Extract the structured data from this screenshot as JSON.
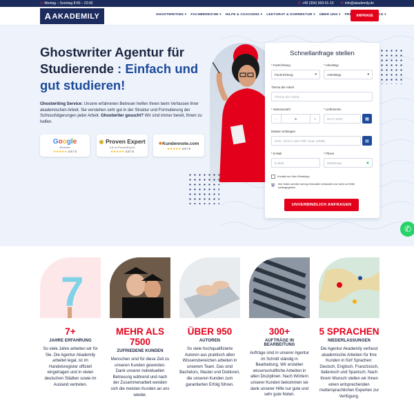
{
  "topbar": {
    "hours": "Montag – Sonntag 8:00 – 23:00",
    "phone": "+49 (304) 669-01-10",
    "email": "info@akademily.de"
  },
  "header": {
    "logo_text": "AKADEMILY",
    "nav": [
      "GHOSTWRITING ▾",
      "FACHBEREICHE ▾",
      "HILFE & COACHING ▾",
      "LEKTORAT & KORREKTUR ▾",
      "ÜBER UNS ▾",
      "PREISE",
      "FAQ",
      "BLOG ▾"
    ],
    "cta": "ANFRAGE"
  },
  "hero": {
    "title_1": "Ghostwriter Agentur für Studierende",
    "title_2": " : Einfach und gut studieren!",
    "lead_b1": "Ghostwriting Service:",
    "lead_t1": " Unsere erfahrenen Betreuer helfen Ihnen beim Verfassen ihrer akademischen Arbeit. Sie verstehen sehr gut in der Struktur und Formulierung der Schlussfolgerungen jeder Arbeit. ",
    "lead_b2": "Ghostwriter gesucht?",
    "lead_t2": " Wir sind immer bereit, Ihnen zu helfen.",
    "badges": [
      {
        "name": "Google",
        "sub": "Reviews",
        "rating": "4.8 / 5"
      },
      {
        "name": "Proven Expert",
        "sub": "4.8 on ProvenExpert",
        "rating": "4.8 / 5"
      },
      {
        "name": "Kundennote.com",
        "sub": "",
        "rating": "4.9 / 5"
      }
    ],
    "stars": "★★★★★"
  },
  "form": {
    "title": "Schnellanfrage stellen",
    "l_fach": "* Fachrichtung",
    "v_fach": "Fachrichtung",
    "l_art": "* Arbeitstyp",
    "v_art": "Arbeitstyp",
    "l_thema": "Thema der Arbeit",
    "p_thema": "Thema der Arbeit...",
    "l_seiten": "* Seitenanzahl",
    "v_seiten": "5",
    "minus": "-",
    "plus": "+",
    "l_termin": "* Liefertermin",
    "p_termin": "02.07.2024",
    "l_datei": "Dateien anhängen",
    "p_datei": "DOC, DOCX oder PDF (max 10MB)",
    "l_email": "* E-Mail",
    "p_email": "E-Mail",
    "l_phone": "* Phone",
    "p_phone": "WhatsApp",
    "cb1": "Kontakt nur über WhatsApp",
    "cb2": "Ihre Daten werden streng vertraulich behandelt und nicht an Dritte weitergegeben.",
    "submit": "UNVERBINDLICH ANFRAGEN"
  },
  "stats": [
    {
      "num": "7+",
      "label": "JAHRE ERFAHRUNG",
      "text": "So viele Jahre arbeiten wir für Sie. Die Agentur Akademily arbeitet legal, ist im Handelsregister offiziell eingetragen und in vielen deutschen Städten sowie im Ausland vertreten."
    },
    {
      "num": "MEHR ALS 7500",
      "label": "ZUFRIEDENE KUNDEN",
      "text": "Menschen sind für diese Zeit zu unseren Kunden geworden. Dank unserer individuellen Betreuung während und nach der Zusammenarbeit wenden sich die meisten Kunden an uns wieder."
    },
    {
      "num": "ÜBER 950",
      "label": "AUTOREN",
      "text": "So viele hochqualifizierte Autoren aus praktisch allen Wissensbereichen arbeiten in unserem Team. Das sind Bachelors, Master und Doktoren, die unseren Kunden zum garantierten Erfolg führen."
    },
    {
      "num": "300+",
      "label": "AUFTRÄGE IN BEARBEITUNG",
      "text": "Aufträge sind in unserer Agentur im Schnitt ständig in Bearbeitung. Wir erstellen wissenschaftliche Arbeiten in allen Disziplinen. Nach Wörtern unserer Kunden bekommen sie dank unserer Hilfe nur gute und sehr gute Noten."
    },
    {
      "num": "5 SPRACHEN",
      "label": "NIEDERLASSUNGEN",
      "text": "Die Agentur Akademily verfasst akademische Arbeiten für Ihre Kunden in fünf Sprachen: Deutsch, Englisch, Französisch, Italienisch und Spanisch. Nach Ihrem Wunsch stellen wir Ihnen einen entsprechenden muttersprachlichen Experten zur Verfügung."
    }
  ],
  "colors": {
    "navy": "#1b2b5c",
    "red": "#e3001b",
    "blue": "#1d4a9a",
    "whatsapp": "#25d366"
  }
}
